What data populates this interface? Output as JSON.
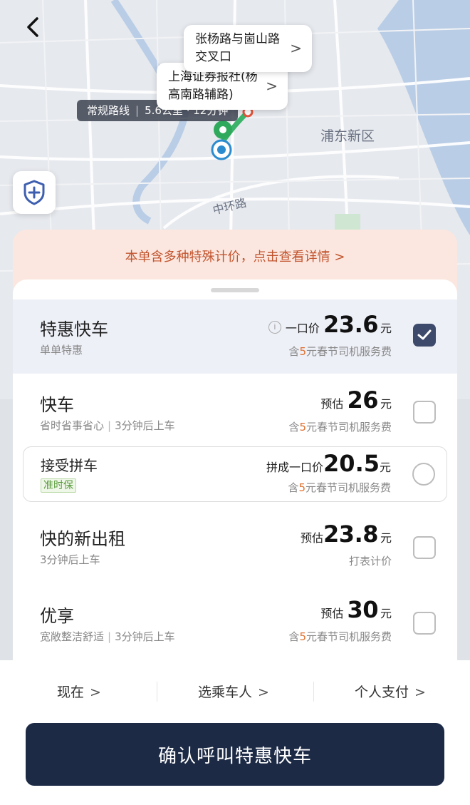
{
  "map": {
    "bubble1": "张杨路与崮山路交叉口",
    "bubble2": "上海证券报社(杨高南路辅路)",
    "route_tag": {
      "label": "常规路线",
      "detail": "5.6公里 · 12分钟"
    },
    "labels": {
      "pudong": "浦东新区",
      "zhonghuan": "中环路"
    }
  },
  "notice": "本单含多种特殊计价，点击查看详情 >",
  "options": [
    {
      "name": "特惠快车",
      "sub": "单单特惠",
      "price_prefix": "一口价",
      "price": "23.6",
      "unit": "元",
      "fee_pre": "含",
      "fee_num": "5",
      "fee_post": "元春节司机服务费",
      "selected": true
    },
    {
      "name": "快车",
      "sub1": "省时省事省心",
      "sub2": "3分钟后上车",
      "price_prefix": "预估",
      "price": "26",
      "unit": "元",
      "fee_pre": "含",
      "fee_num": "5",
      "fee_post": "元春节司机服务费",
      "selected": false
    },
    {
      "name": "快的新出租",
      "sub": "3分钟后上车",
      "price_prefix": "预估",
      "price": "23.8",
      "unit": "元",
      "fee": "打表计价",
      "selected": false
    },
    {
      "name": "优享",
      "sub1": "宽敞整洁舒适",
      "sub2": "3分钟后上车",
      "price_prefix": "预估",
      "price": "30",
      "unit": "元",
      "fee_pre": "含",
      "fee_num": "5",
      "fee_post": "元春节司机服务费",
      "selected": false
    }
  ],
  "pool": {
    "name": "接受拼车",
    "tag": "准时保",
    "price_prefix": "拼成一口价",
    "price": "20.5",
    "unit": "元",
    "fee_pre": "含",
    "fee_num": "5",
    "fee_post": "元春节司机服务费"
  },
  "bottom": {
    "time": "现在",
    "passenger": "选乘车人",
    "payment": "个人支付",
    "chevron": ">",
    "confirm": "确认呼叫特惠快车"
  },
  "colors": {
    "accent": "#3e4a6b",
    "confirm_bg": "#1c2a45",
    "notice_text": "#c2552f",
    "fee_highlight": "#e0702f"
  }
}
